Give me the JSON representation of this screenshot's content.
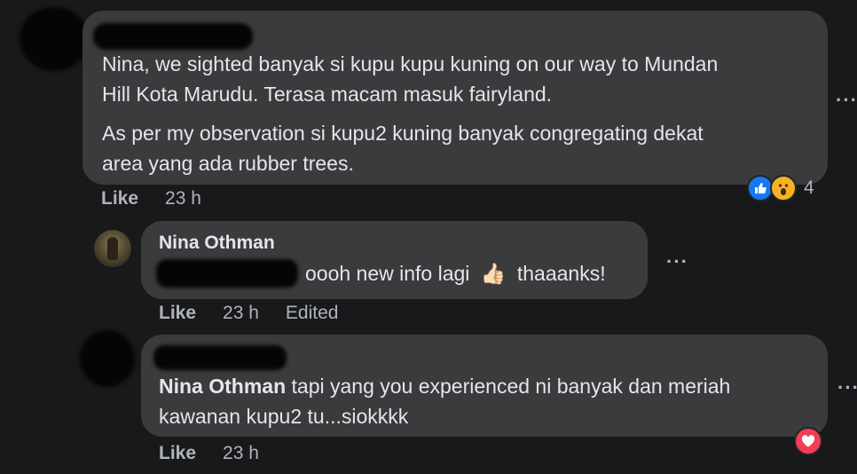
{
  "comments": [
    {
      "lines": [
        "Nina, we sighted banyak si kupu kupu kuning on our way to Mundan",
        "Hill Kota Marudu. Terasa macam masuk fairyland.",
        "As per my observation si kupu2 kuning banyak congregating dekat",
        "area yang ada rubber trees."
      ],
      "like_label": "Like",
      "time": "23 h",
      "reaction_count": "4"
    },
    {
      "author": "Nina Othman",
      "text": "oooh new info lagi",
      "emoji": "👍🏻",
      "text2": "thaaanks!",
      "like_label": "Like",
      "time": "23 h",
      "edited_label": "Edited"
    },
    {
      "author": "Nina Othman",
      "text_line1": "tapi yang you experienced ni banyak dan meriah",
      "text_line2": "kawanan kupu2 tu...siokkkk",
      "like_label": "Like",
      "time": "23 h"
    }
  ],
  "more_icon": "ellipsis-icon",
  "reaction_icons": [
    "like-reaction-icon",
    "wow-reaction-icon",
    "love-reaction-icon"
  ],
  "colors": {
    "background": "#18191a",
    "bubble": "#3a3b3c",
    "like_blue": "#1877f2",
    "wow_yellow": "#f7b125",
    "love_red": "#f33e58"
  }
}
